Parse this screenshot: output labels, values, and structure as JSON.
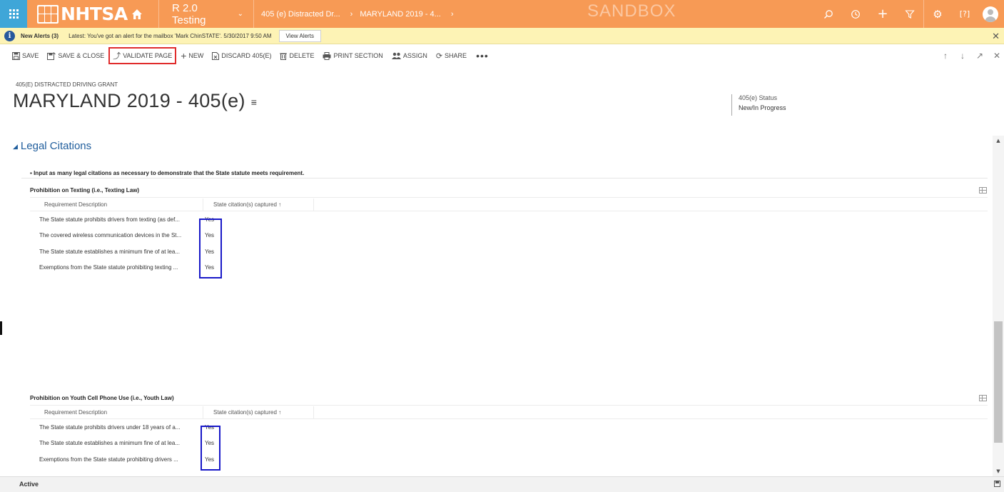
{
  "nav": {
    "logo_text": "NHTSA",
    "app_name": "R 2.0 Testing",
    "breadcrumb_entity": "405 (e) Distracted Dr...",
    "breadcrumb_record": "MARYLAND 2019 - 4...",
    "environment": "SANDBOX",
    "colors": {
      "bar": "#f79a55",
      "apps_button": "#3fa6d8"
    },
    "right_icons": [
      "search-icon",
      "history-icon",
      "plus-icon",
      "filter-icon",
      "settings-icon",
      "help-icon",
      "user-avatar"
    ]
  },
  "alert": {
    "title": "New Alerts (3)",
    "message": "Latest: You've got an alert for the mailbox 'Mark ChinSTATE'. 5/30/2017 9:50 AM",
    "button": "View Alerts"
  },
  "toolbar": {
    "save": "SAVE",
    "save_close": "SAVE & CLOSE",
    "validate_page": "VALIDATE PAGE",
    "new": "NEW",
    "discard": "DISCARD 405(E)",
    "delete": "DELETE",
    "print_section": "PRINT SECTION",
    "assign": "ASSIGN",
    "share": "SHARE",
    "more": "•••"
  },
  "header": {
    "entity_label": "405(E) DISTRACTED DRIVING GRANT",
    "title": "MARYLAND 2019 - 405(e)",
    "status_label": "405(e) Status",
    "status_value": "New/In Progress"
  },
  "section": {
    "title": "Legal Citations",
    "note": "Input as many legal citations as necessary to demonstrate that the State statute meets requirement."
  },
  "grids": [
    {
      "title": "Prohibition on Texting (i.e., Texting Law)",
      "col_desc": "Requirement Description",
      "col_val": "State citation(s) captured",
      "rows": [
        {
          "desc": "The State statute prohibits drivers from texting (as def...",
          "val": "Yes"
        },
        {
          "desc": "The covered wireless communication devices in the St...",
          "val": "Yes"
        },
        {
          "desc": "The State statute establishes a minimum fine of at lea...",
          "val": "Yes"
        },
        {
          "desc": "Exemptions from the State statute prohibiting texting ...",
          "val": "Yes"
        }
      ]
    },
    {
      "title": "Prohibition on Youth Cell Phone Use (i.e., Youth Law)",
      "col_desc": "Requirement Description",
      "col_val": "State citation(s) captured",
      "rows": [
        {
          "desc": "The State statute prohibits drivers under 18 years of a...",
          "val": "Yes"
        },
        {
          "desc": "The State statute establishes a minimum fine of at lea...",
          "val": "Yes"
        },
        {
          "desc": "Exemptions from the State statute prohibiting drivers ...",
          "val": "Yes"
        }
      ]
    }
  ],
  "footer": {
    "status": "Active"
  }
}
